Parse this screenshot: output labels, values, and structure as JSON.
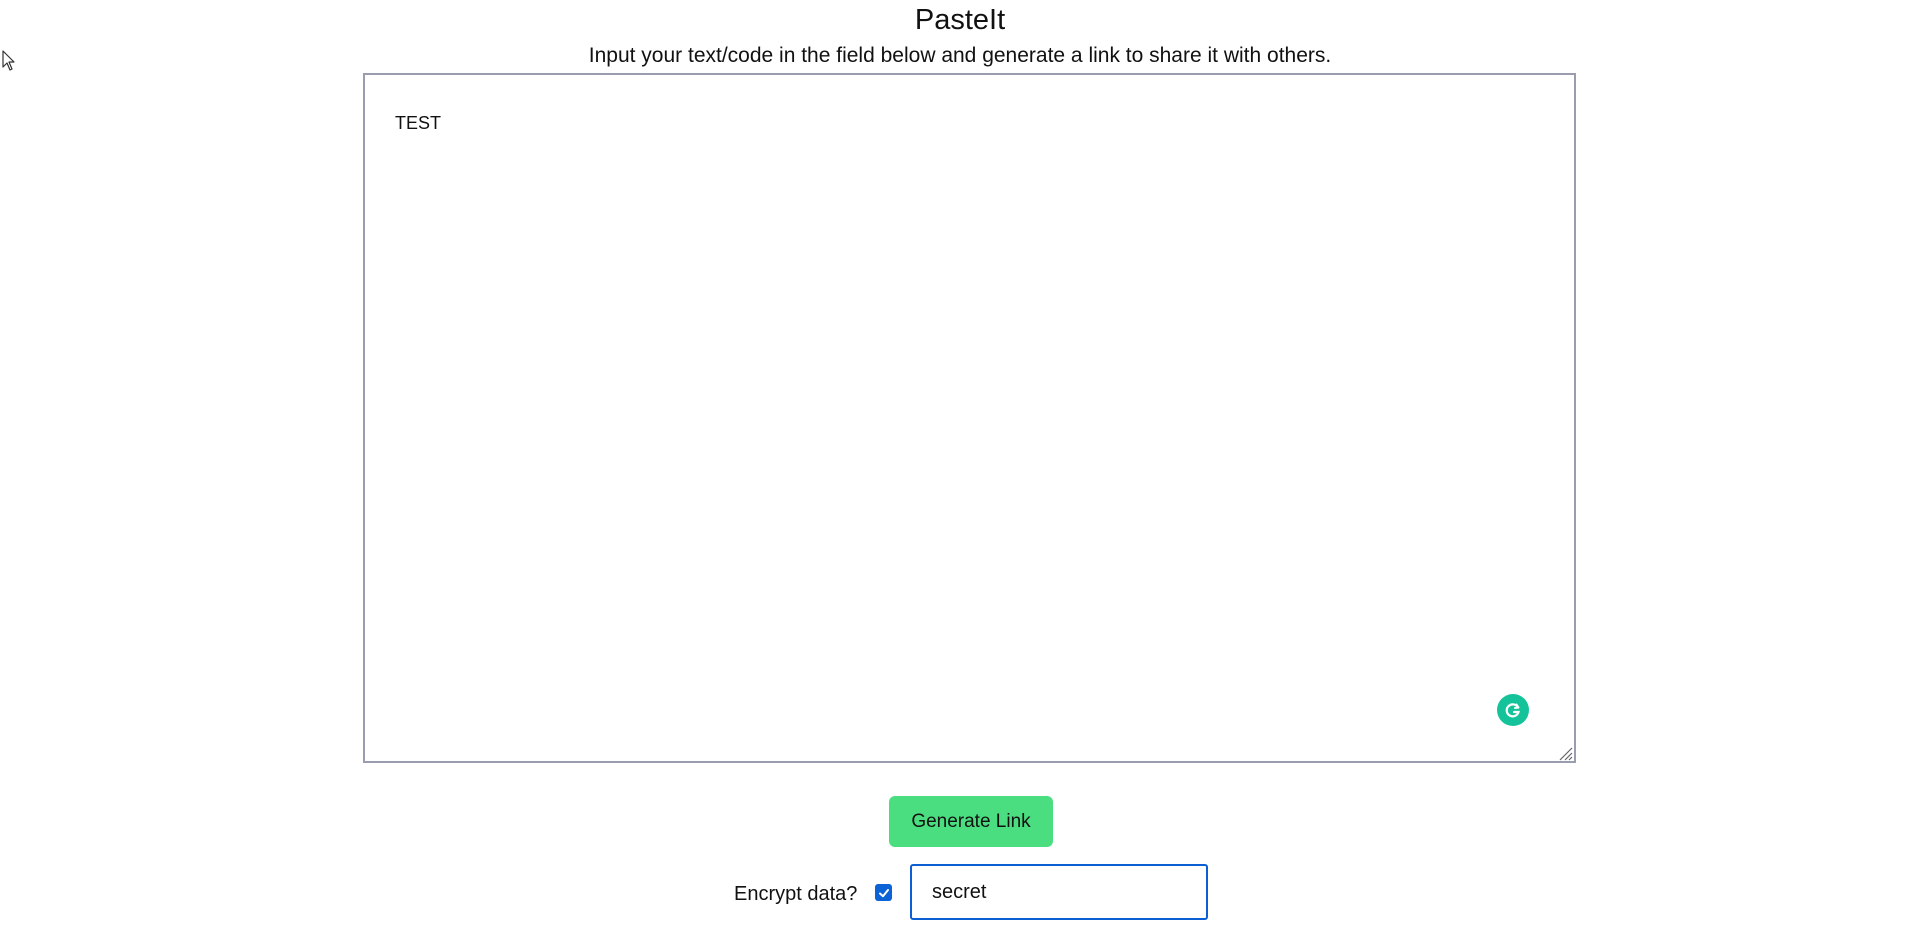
{
  "app": {
    "title": "PasteIt",
    "subtitle": "Input your text/code in the field below and generate a link to share it with others."
  },
  "editor": {
    "value": "TEST",
    "placeholder": ""
  },
  "actions": {
    "generate_label": "Generate Link"
  },
  "encryption": {
    "label": "Encrypt data?",
    "checked": true,
    "password_value": "secret"
  },
  "icons": {
    "grammarly": "grammarly-icon",
    "resize": "resize-handle-icon",
    "cursor": "mouse-cursor-icon",
    "checkmark": "checkmark-icon"
  },
  "colors": {
    "button": "#4ade80",
    "checkbox": "#0b63d6",
    "input_focus_border": "#0b5fd3",
    "editor_border": "#9a9cb0",
    "grammarly": "#15c39a"
  }
}
